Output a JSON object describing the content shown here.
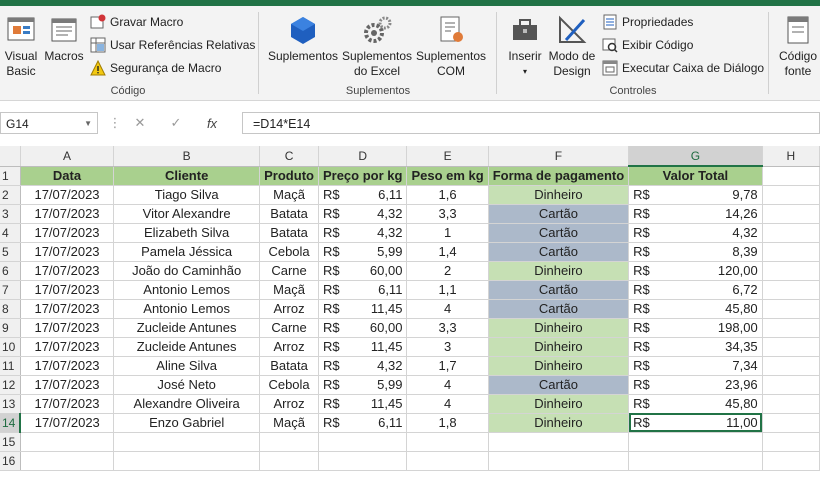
{
  "ribbon": {
    "groups": {
      "codigo": {
        "label": "Código",
        "visual_basic": [
          "Visual",
          "Basic"
        ],
        "macros": "Macros",
        "gravar_macro": "Gravar Macro",
        "usar_referencias": "Usar Referências Relativas",
        "seguranca_macro": "Segurança de Macro"
      },
      "suplementos": {
        "label": "Suplementos",
        "suplementos": "Suplementos",
        "suplementos_excel": [
          "Suplementos",
          "do Excel"
        ],
        "suplementos_com": [
          "Suplementos",
          "COM"
        ]
      },
      "controles": {
        "label": "Controles",
        "inserir": "Inserir",
        "modo_design": [
          "Modo de",
          "Design"
        ],
        "propriedades": "Propriedades",
        "exibir_codigo": "Exibir Código",
        "executar_caixa": "Executar Caixa de Diálogo"
      },
      "xml": {
        "codigo_fonte": [
          "Código",
          "fonte"
        ]
      }
    }
  },
  "formula_bar": {
    "name_box": "G14",
    "formula": "=D14*E14",
    "fx": "fx"
  },
  "columns": [
    "A",
    "B",
    "C",
    "D",
    "E",
    "F",
    "G",
    "H"
  ],
  "selected_column": "G",
  "selected_row": 14,
  "headers": {
    "data": "Data",
    "cliente": "Cliente",
    "produto": "Produto",
    "preco": "Preço por kg",
    "peso": "Peso em kg",
    "forma": "Forma de pagamento",
    "valor": "Valor Total"
  },
  "currency": "R$",
  "rows": [
    {
      "data": "17/07/2023",
      "cliente": "Tiago Silva",
      "produto": "Maçã",
      "preco": "6,11",
      "peso": "1,6",
      "forma": "Dinheiro",
      "valor": "9,78"
    },
    {
      "data": "17/07/2023",
      "cliente": "Vitor Alexandre",
      "produto": "Batata",
      "preco": "4,32",
      "peso": "3,3",
      "forma": "Cartão",
      "valor": "14,26"
    },
    {
      "data": "17/07/2023",
      "cliente": "Elizabeth Silva",
      "produto": "Batata",
      "preco": "4,32",
      "peso": "1",
      "forma": "Cartão",
      "valor": "4,32"
    },
    {
      "data": "17/07/2023",
      "cliente": "Pamela Jéssica",
      "produto": "Cebola",
      "preco": "5,99",
      "peso": "1,4",
      "forma": "Cartão",
      "valor": "8,39"
    },
    {
      "data": "17/07/2023",
      "cliente": "João do Caminhão",
      "produto": "Carne",
      "preco": "60,00",
      "peso": "2",
      "forma": "Dinheiro",
      "valor": "120,00"
    },
    {
      "data": "17/07/2023",
      "cliente": "Antonio Lemos",
      "produto": "Maçã",
      "preco": "6,11",
      "peso": "1,1",
      "forma": "Cartão",
      "valor": "6,72"
    },
    {
      "data": "17/07/2023",
      "cliente": "Antonio Lemos",
      "produto": "Arroz",
      "preco": "11,45",
      "peso": "4",
      "forma": "Cartão",
      "valor": "45,80"
    },
    {
      "data": "17/07/2023",
      "cliente": "Zucleide Antunes",
      "produto": "Carne",
      "preco": "60,00",
      "peso": "3,3",
      "forma": "Dinheiro",
      "valor": "198,00"
    },
    {
      "data": "17/07/2023",
      "cliente": "Zucleide Antunes",
      "produto": "Arroz",
      "preco": "11,45",
      "peso": "3",
      "forma": "Dinheiro",
      "valor": "34,35"
    },
    {
      "data": "17/07/2023",
      "cliente": "Aline Silva",
      "produto": "Batata",
      "preco": "4,32",
      "peso": "1,7",
      "forma": "Dinheiro",
      "valor": "7,34"
    },
    {
      "data": "17/07/2023",
      "cliente": "José Neto",
      "produto": "Cebola",
      "preco": "5,99",
      "peso": "4",
      "forma": "Cartão",
      "valor": "23,96"
    },
    {
      "data": "17/07/2023",
      "cliente": "Alexandre Oliveira",
      "produto": "Arroz",
      "preco": "11,45",
      "peso": "4",
      "forma": "Dinheiro",
      "valor": "45,80"
    },
    {
      "data": "17/07/2023",
      "cliente": "Enzo Gabriel",
      "produto": "Maçã",
      "preco": "6,11",
      "peso": "1,8",
      "forma": "Dinheiro",
      "valor": "11,00"
    }
  ],
  "empty_rows": [
    15,
    16
  ],
  "colors": {
    "header_fill": "#a9d08e",
    "dinheiro_fill": "#c6e0b4",
    "cartao_fill": "#acb9ca",
    "excel_green": "#217346"
  }
}
